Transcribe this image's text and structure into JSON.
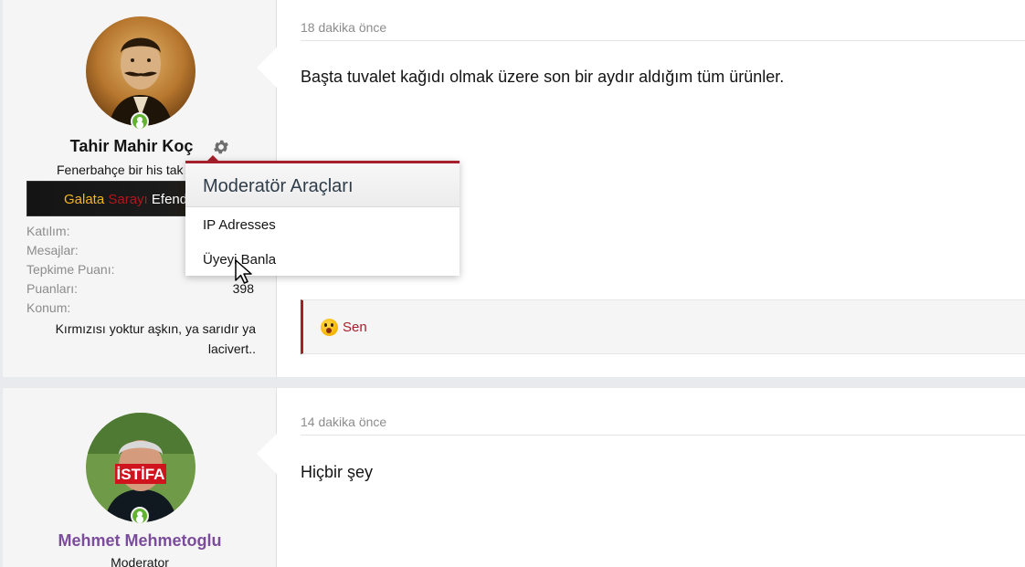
{
  "posts": [
    {
      "user": {
        "name": "Tahir Mahir Koç",
        "title": "Fenerbahçe bir his tak",
        "banner": [
          "Galata",
          "Sarayı",
          "Efend"
        ],
        "stats": [
          {
            "label": "Katılım:",
            "value": ""
          },
          {
            "label": "Mesajlar:",
            "value": ""
          },
          {
            "label": "Tepkime Puanı:",
            "value": ""
          },
          {
            "label": "Puanları:",
            "value": "398"
          },
          {
            "label": "Konum:",
            "value": ""
          }
        ],
        "location": [
          "Kırmızısı yoktur aşkın, ya sarıdır ya",
          "lacivert.."
        ]
      },
      "time": "18 dakika önce",
      "message": "Başta tuvalet kağıdı olmak üzere son bir aydır aldığım tüm ürünler.",
      "reaction": {
        "icon": "shocked-emoji-icon",
        "text": "Sen"
      }
    },
    {
      "user": {
        "name": "Mehmet Mehmetoglu",
        "title": "Moderator",
        "avatar_text": "İSTİFA"
      },
      "time": "14 dakika önce",
      "message": "Hiçbir şey"
    }
  ],
  "mod_menu": {
    "title": "Moderatör Araçları",
    "items": [
      "IP Adresses",
      "Üyeyi Banla"
    ]
  },
  "colors": {
    "accent": "#a5202a",
    "online": "#63b233",
    "moderator_name": "#7b4c9c"
  }
}
